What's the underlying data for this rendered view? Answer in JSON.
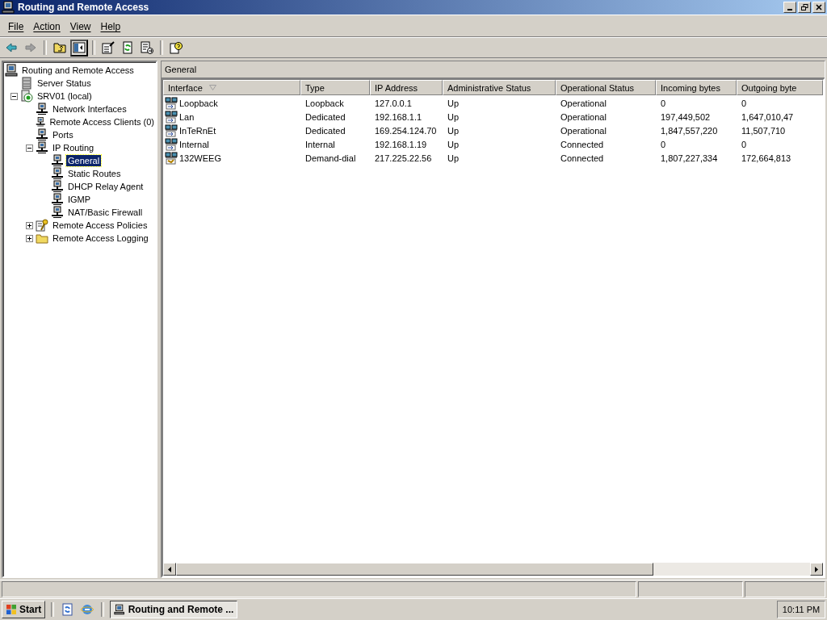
{
  "window": {
    "title": "Routing and Remote Access"
  },
  "menu": [
    {
      "label": "File"
    },
    {
      "label": "Action"
    },
    {
      "label": "View"
    },
    {
      "label": "Help"
    }
  ],
  "toolbar": [
    {
      "kind": "back",
      "disabled": false,
      "pressed": false
    },
    {
      "kind": "forward",
      "disabled": true,
      "pressed": false
    },
    {
      "kind": "up",
      "pressed": false
    },
    {
      "kind": "tree",
      "pressed": true
    },
    {
      "kind": "properties",
      "pressed": false
    },
    {
      "kind": "refresh",
      "pressed": false
    },
    {
      "kind": "export",
      "pressed": false
    },
    {
      "kind": "help",
      "pressed": false
    }
  ],
  "tree": [
    {
      "label": "Routing and Remote Access",
      "kind": "computer",
      "selected": false,
      "children": [
        {
          "label": "Server Status",
          "kind": "server",
          "selected": false
        },
        {
          "label": "SRV01 (local)",
          "kind": "host",
          "selected": false,
          "expanded": true,
          "children": [
            {
              "label": "Network Interfaces",
              "kind": "network",
              "selected": false
            },
            {
              "label": "Remote Access Clients (0)",
              "kind": "network",
              "selected": false
            },
            {
              "label": "Ports",
              "kind": "network",
              "selected": false
            },
            {
              "label": "IP Routing",
              "kind": "network",
              "selected": false,
              "expanded": true,
              "children": [
                {
                  "label": "General",
                  "kind": "network",
                  "selected": true
                },
                {
                  "label": "Static Routes",
                  "kind": "network",
                  "selected": false
                },
                {
                  "label": "DHCP Relay Agent",
                  "kind": "network",
                  "selected": false
                },
                {
                  "label": "IGMP",
                  "kind": "network",
                  "selected": false
                },
                {
                  "label": "NAT/Basic Firewall",
                  "kind": "network",
                  "selected": false
                }
              ]
            },
            {
              "label": "Remote Access Policies",
              "kind": "policy",
              "selected": false,
              "expanded": false
            },
            {
              "label": "Remote Access Logging",
              "kind": "folder",
              "selected": false,
              "expanded": false
            }
          ]
        }
      ]
    }
  ],
  "panel": {
    "title": "General"
  },
  "table": {
    "columns": [
      "Interface",
      "Type",
      "IP Address",
      "Administrative Status",
      "Operational Status",
      "Incoming bytes",
      "Outgoing byte"
    ],
    "rows": [
      {
        "kind": "dedicated",
        "cells": [
          "Loopback",
          "Loopback",
          "127.0.0.1",
          "Up",
          "Operational",
          "0",
          "0"
        ]
      },
      {
        "kind": "dedicated",
        "cells": [
          "Lan",
          "Dedicated",
          "192.168.1.1",
          "Up",
          "Operational",
          "197,449,502",
          "1,647,010,47"
        ]
      },
      {
        "kind": "dedicated",
        "cells": [
          "InTeRnEt",
          "Dedicated",
          "169.254.124.70",
          "Up",
          "Operational",
          "1,847,557,220",
          "11,507,710"
        ]
      },
      {
        "kind": "dedicated",
        "cells": [
          "Internal",
          "Internal",
          "192.168.1.19",
          "Up",
          "Connected",
          "0",
          "0"
        ]
      },
      {
        "kind": "demand",
        "cells": [
          "132WEEG",
          "Demand-dial",
          "217.225.22.56",
          "Up",
          "Connected",
          "1,807,227,334",
          "172,664,813"
        ]
      }
    ]
  },
  "taskbar": {
    "start": "Start",
    "task": "Routing and Remote ...",
    "clock": "10:11 PM"
  }
}
